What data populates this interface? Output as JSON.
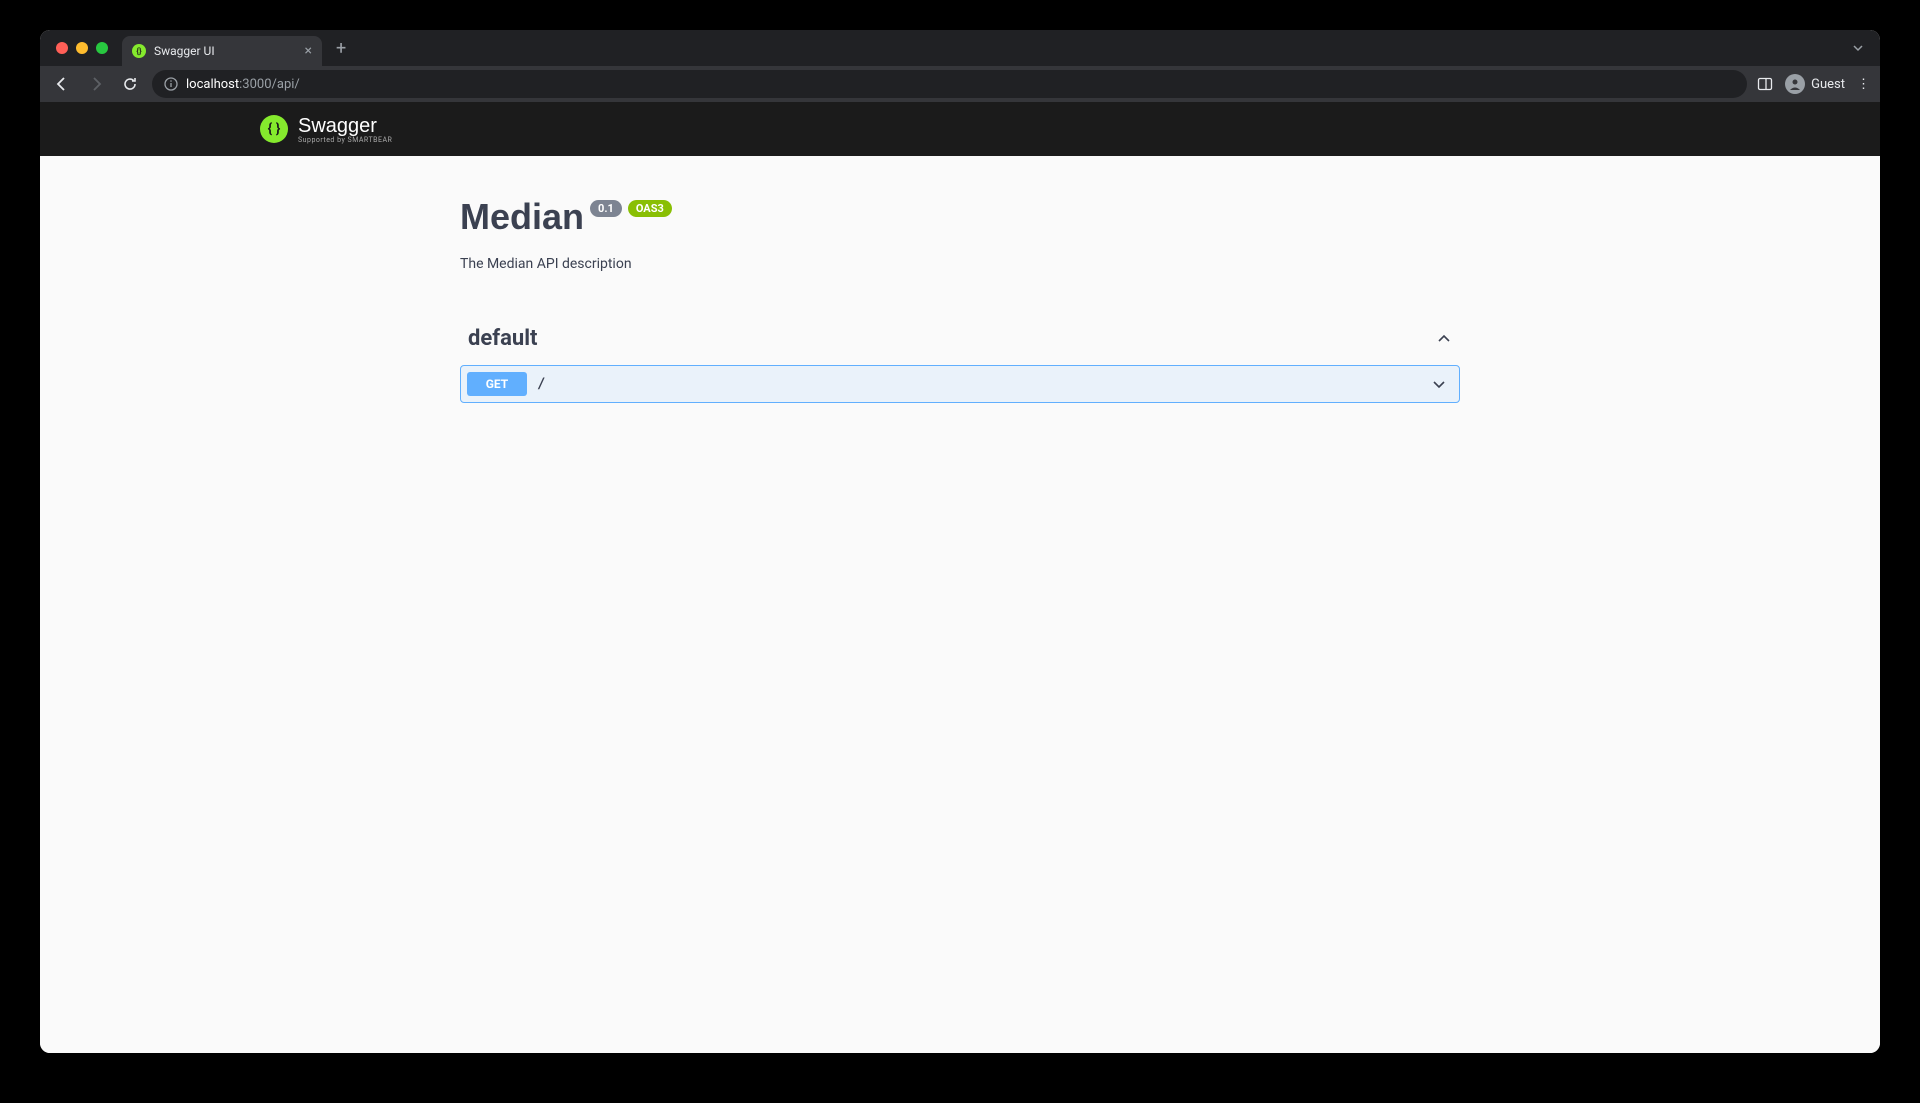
{
  "browser": {
    "tab": {
      "title": "Swagger UI"
    },
    "url_host": "localhost",
    "url_port": ":3000",
    "url_path": "/api/",
    "guest_label": "Guest"
  },
  "swagger": {
    "logo_text": "Swagger",
    "logo_sub": "Supported by SMARTBEAR"
  },
  "api": {
    "title": "Median",
    "version": "0.1",
    "oas": "OAS3",
    "description": "The Median API description"
  },
  "tags": [
    {
      "name": "default",
      "operations": [
        {
          "method": "GET",
          "path": "/"
        }
      ]
    }
  ]
}
